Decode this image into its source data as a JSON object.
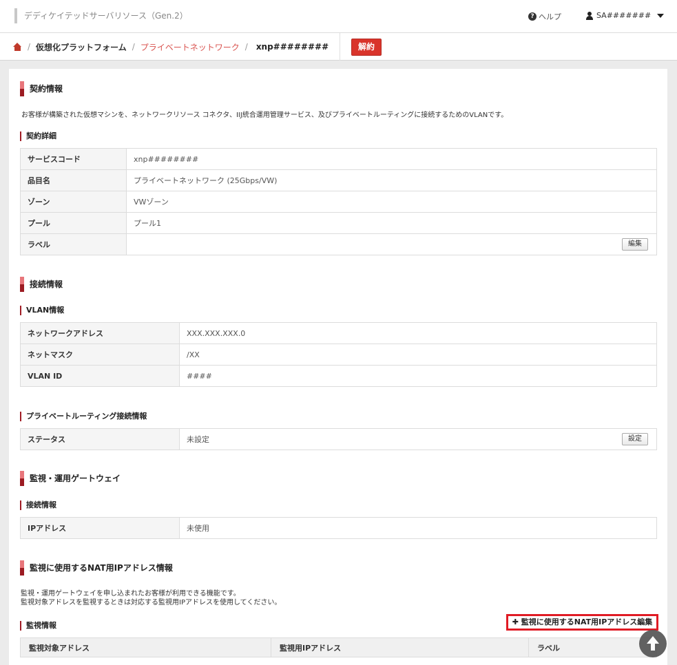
{
  "header": {
    "app_title": "デディケイテッドサーバリソース（Gen.2）",
    "help_label": "ヘルプ",
    "user_label": "SA#######"
  },
  "breadcrumb": {
    "items": [
      "仮想化プラットフォーム",
      "プライベートネットワーク"
    ],
    "current": "xnp########",
    "cancel_button": "解約"
  },
  "contract": {
    "title": "契約情報",
    "description": "お客様が構築された仮想マシンを、ネットワークリソース コネクタ、IIJ統合運用管理サービス、及びプライベートルーティングに接続するためのVLANです。",
    "detail_title": "契約詳細",
    "rows": [
      {
        "key": "サービスコード",
        "value": "xnp########"
      },
      {
        "key": "品目名",
        "value": "プライベートネットワーク (25Gbps/VW)"
      },
      {
        "key": "ゾーン",
        "value": "VWゾーン"
      },
      {
        "key": "プール",
        "value": "プール1"
      },
      {
        "key": "ラベル",
        "value": ""
      }
    ],
    "edit_button": "編集"
  },
  "connection": {
    "title": "接続情報",
    "vlan_title": "VLAN情報",
    "vlan_rows": [
      {
        "key": "ネットワークアドレス",
        "value": "XXX.XXX.XXX.0"
      },
      {
        "key": "ネットマスク",
        "value": "/XX"
      },
      {
        "key": "VLAN ID",
        "value": "####"
      }
    ],
    "routing_title": "プライベートルーティング接続情報",
    "routing_rows": [
      {
        "key": "ステータス",
        "value": "未設定"
      }
    ],
    "settings_button": "設定"
  },
  "gateway": {
    "title": "監視・運用ゲートウェイ",
    "conn_title": "接続情報",
    "rows": [
      {
        "key": "IPアドレス",
        "value": "未使用"
      }
    ]
  },
  "nat": {
    "title": "監視に使用するNAT用IPアドレス情報",
    "desc_line1": "監視・運用ゲートウェイを申し込まれたお客様が利用できる機能です。",
    "desc_line2": "監視対象アドレスを監視するときは対応する監視用IPアドレスを使用してください。",
    "edit_button": "✚ 監視に使用するNAT用IPアドレス編集",
    "monitor_title": "監視情報",
    "columns": [
      "監視対象アドレス",
      "監視用IPアドレス",
      "ラベル"
    ]
  }
}
